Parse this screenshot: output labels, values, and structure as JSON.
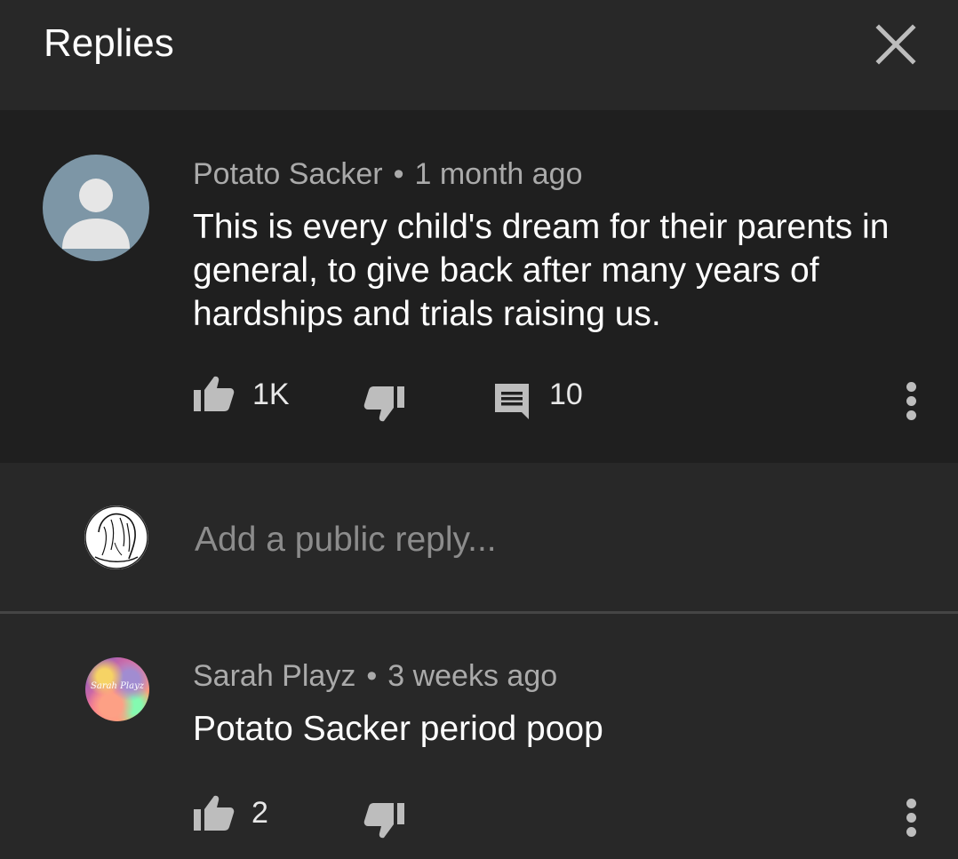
{
  "header": {
    "title": "Replies",
    "close_icon": "close-icon"
  },
  "main_comment": {
    "author": "Potato Sacker",
    "separator": "•",
    "time": "1 month ago",
    "text": "This is every child's dream for their parents in general, to give back after many years of hardships and trials raising us.",
    "likes": "1K",
    "replies": "10",
    "avatar_icon": "default-user-avatar"
  },
  "reply_input": {
    "placeholder": "Add a public reply..."
  },
  "replies": [
    {
      "author": "Sarah Playz",
      "separator": "•",
      "time": "3 weeks ago",
      "text": "Potato Sacker period poop",
      "likes": "2",
      "avatar_text": "Sarah Playz"
    }
  ],
  "colors": {
    "background": "#282828",
    "highlight_background": "#1f1f1f",
    "meta_text": "#aaaaaa",
    "body_text": "#ffffff"
  }
}
